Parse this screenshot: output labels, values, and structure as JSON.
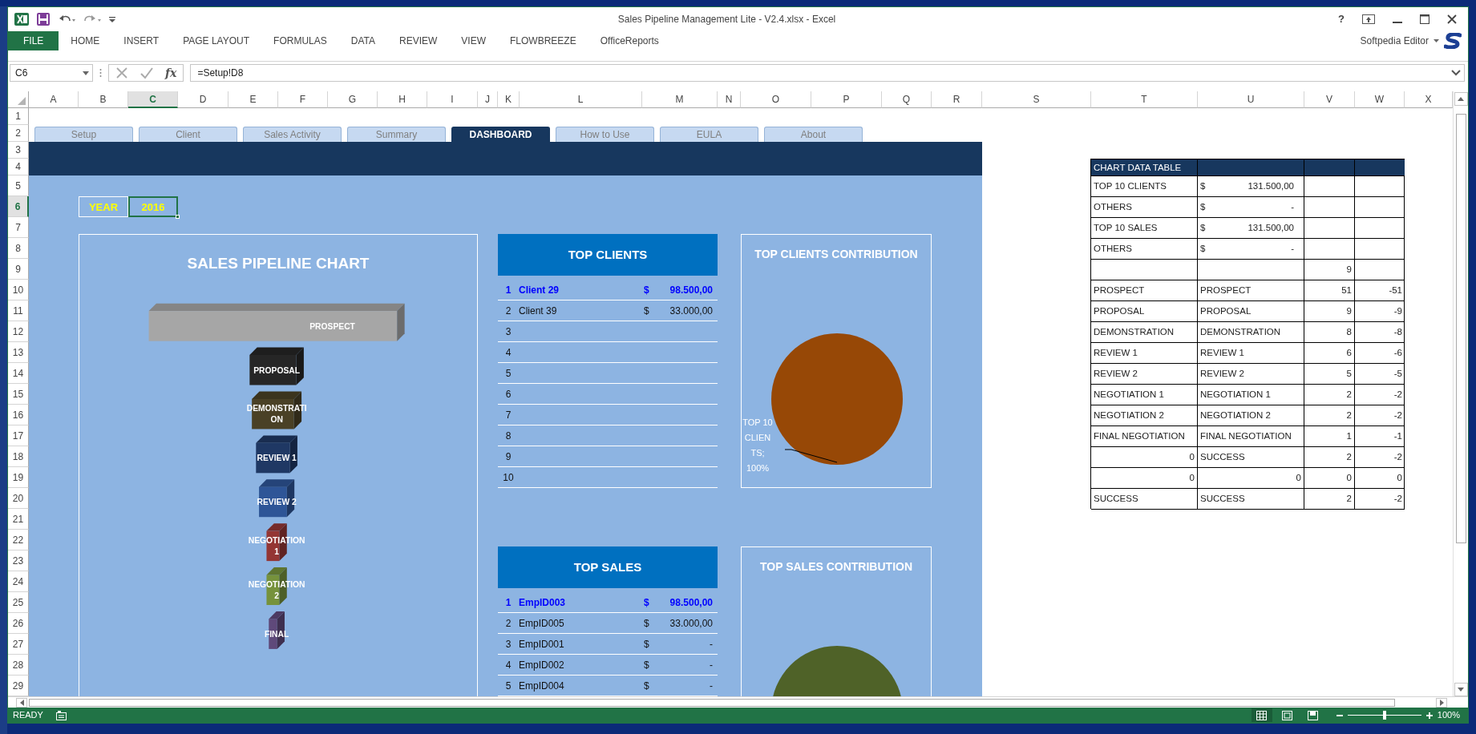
{
  "window": {
    "title": "Sales Pipeline Management Lite - V2.4.xlsx - Excel",
    "help_label": "?"
  },
  "ribbon": {
    "tabs": [
      {
        "label": "FILE",
        "kind": "file"
      },
      {
        "label": "HOME",
        "kind": "tab"
      },
      {
        "label": "INSERT",
        "kind": "tab"
      },
      {
        "label": "PAGE LAYOUT",
        "kind": "tab"
      },
      {
        "label": "FORMULAS",
        "kind": "tab"
      },
      {
        "label": "DATA",
        "kind": "tab"
      },
      {
        "label": "REVIEW",
        "kind": "tab"
      },
      {
        "label": "VIEW",
        "kind": "tab"
      },
      {
        "label": "FLOWBREEZE",
        "kind": "tab"
      },
      {
        "label": "OfficeReports",
        "kind": "tab"
      }
    ],
    "user": "Softpedia Editor"
  },
  "formula_bar": {
    "name_box": "C6",
    "function_label": "fx",
    "formula": "=Setup!D8"
  },
  "columns": [
    {
      "label": "A",
      "selected": false
    },
    {
      "label": "B",
      "selected": false
    },
    {
      "label": "C",
      "selected": true
    },
    {
      "label": "D",
      "selected": false
    },
    {
      "label": "E",
      "selected": false
    },
    {
      "label": "F",
      "selected": false
    },
    {
      "label": "G",
      "selected": false
    },
    {
      "label": "H",
      "selected": false
    },
    {
      "label": "I",
      "selected": false
    },
    {
      "label": "J",
      "selected": false
    },
    {
      "label": "K",
      "selected": false
    },
    {
      "label": "L",
      "selected": false
    },
    {
      "label": "M",
      "selected": false
    },
    {
      "label": "N",
      "selected": false
    },
    {
      "label": "O",
      "selected": false
    },
    {
      "label": "P",
      "selected": false
    },
    {
      "label": "Q",
      "selected": false
    },
    {
      "label": "R",
      "selected": false
    },
    {
      "label": "S",
      "selected": false
    },
    {
      "label": "T",
      "selected": false
    },
    {
      "label": "U",
      "selected": false
    },
    {
      "label": "V",
      "selected": false
    },
    {
      "label": "W",
      "selected": false
    },
    {
      "label": "X",
      "selected": false
    }
  ],
  "rows": [
    {
      "label": "1",
      "selected": false
    },
    {
      "label": "2",
      "selected": false
    },
    {
      "label": "3",
      "selected": false
    },
    {
      "label": "4",
      "selected": false
    },
    {
      "label": "5",
      "selected": false
    },
    {
      "label": "6",
      "selected": true
    },
    {
      "label": "7",
      "selected": false
    },
    {
      "label": "8",
      "selected": false
    },
    {
      "label": "9",
      "selected": false
    },
    {
      "label": "10",
      "selected": false
    },
    {
      "label": "11",
      "selected": false
    },
    {
      "label": "12",
      "selected": false
    },
    {
      "label": "13",
      "selected": false
    },
    {
      "label": "14",
      "selected": false
    },
    {
      "label": "15",
      "selected": false
    },
    {
      "label": "16",
      "selected": false
    },
    {
      "label": "17",
      "selected": false
    },
    {
      "label": "18",
      "selected": false
    },
    {
      "label": "19",
      "selected": false
    },
    {
      "label": "20",
      "selected": false
    },
    {
      "label": "21",
      "selected": false
    },
    {
      "label": "22",
      "selected": false
    },
    {
      "label": "23",
      "selected": false
    },
    {
      "label": "24",
      "selected": false
    },
    {
      "label": "25",
      "selected": false
    },
    {
      "label": "26",
      "selected": false
    },
    {
      "label": "27",
      "selected": false
    },
    {
      "label": "28",
      "selected": false
    },
    {
      "label": "29",
      "selected": false
    }
  ],
  "sheet_tabs": [
    {
      "label": "Setup",
      "selected": false
    },
    {
      "label": "Client",
      "selected": false
    },
    {
      "label": "Sales Activity",
      "selected": false
    },
    {
      "label": "Summary",
      "selected": false
    },
    {
      "label": "DASHBOARD",
      "selected": true
    },
    {
      "label": "How to Use",
      "selected": false
    },
    {
      "label": "EULA",
      "selected": false
    },
    {
      "label": "About",
      "selected": false
    }
  ],
  "year": {
    "label": "YEAR",
    "value": "2016",
    "selected": true
  },
  "pipeline_chart": {
    "title": "SALES PIPELINE CHART",
    "stages": [
      {
        "label_lines": [
          "PROSPECT"
        ],
        "color": "#a6a6a6"
      },
      {
        "label_lines": [
          "PROPOSAL"
        ],
        "color": "#262626"
      },
      {
        "label_lines": [
          "DEMONSTRATI",
          "ON"
        ],
        "color": "#4a4126"
      },
      {
        "label_lines": [
          "REVIEW 1"
        ],
        "color": "#1f3864"
      },
      {
        "label_lines": [
          "REVIEW 2"
        ],
        "color": "#2e5597"
      },
      {
        "label_lines": [
          "NEGOTIATION",
          "1"
        ],
        "color": "#943634"
      },
      {
        "label_lines": [
          "NEGOTIATION",
          "2"
        ],
        "color": "#76923c"
      },
      {
        "label_lines": [
          "FINAL"
        ],
        "color": "#5f497a"
      }
    ]
  },
  "top_clients": {
    "title": "TOP CLIENTS",
    "rows": [
      {
        "rank": "1",
        "name": "Client 29",
        "currency": "$",
        "amount": "98.500,00",
        "highlighted": true
      },
      {
        "rank": "2",
        "name": "Client 39",
        "currency": "$",
        "amount": "33.000,00",
        "highlighted": false
      },
      {
        "rank": "3",
        "highlighted": false
      },
      {
        "rank": "4",
        "highlighted": false
      },
      {
        "rank": "5",
        "highlighted": false
      },
      {
        "rank": "6",
        "highlighted": false
      },
      {
        "rank": "7",
        "highlighted": false
      },
      {
        "rank": "8",
        "highlighted": false
      },
      {
        "rank": "9",
        "highlighted": false
      },
      {
        "rank": "10",
        "highlighted": false
      }
    ]
  },
  "clients_contribution": {
    "chart_data": {
      "type": "pie",
      "title": "TOP CLIENTS CONTRIBUTION",
      "series": [
        {
          "color": "#974806",
          "values": [
            100
          ]
        }
      ],
      "value_labels": [
        "TOP 10 CLIENTS; 100%"
      ]
    }
  },
  "top_sales": {
    "title": "TOP SALES",
    "rows": [
      {
        "rank": "1",
        "name": "EmpID003",
        "currency": "$",
        "amount": "98.500,00",
        "highlighted": true
      },
      {
        "rank": "2",
        "name": "EmpID005",
        "currency": "$",
        "amount": "33.000,00",
        "highlighted": false
      },
      {
        "rank": "3",
        "name": "EmpID001",
        "currency": "$",
        "amount": "-",
        "highlighted": false
      },
      {
        "rank": "4",
        "name": "EmpID002",
        "currency": "$",
        "amount": "-",
        "highlighted": false
      },
      {
        "rank": "5",
        "name": "EmpID004",
        "currency": "$",
        "amount": "-",
        "highlighted": false
      }
    ]
  },
  "sales_contribution": {
    "title": "TOP SALES CONTRIBUTION"
  },
  "chart_data_table": {
    "title": "CHART DATA TABLE",
    "rows": [
      [
        {
          "kind": "text",
          "text": "TOP 10 CLIENTS"
        },
        {
          "kind": "money",
          "currency": "$",
          "text": "131.500,00"
        },
        {
          "kind": "empty"
        },
        {
          "kind": "empty"
        }
      ],
      [
        {
          "kind": "text",
          "text": "OTHERS"
        },
        {
          "kind": "money",
          "currency": "$",
          "text": "-"
        },
        {
          "kind": "empty"
        },
        {
          "kind": "empty"
        }
      ],
      [
        {
          "kind": "text",
          "text": "TOP 10 SALES"
        },
        {
          "kind": "money",
          "currency": "$",
          "text": "131.500,00"
        },
        {
          "kind": "empty"
        },
        {
          "kind": "empty"
        }
      ],
      [
        {
          "kind": "text",
          "text": "OTHERS"
        },
        {
          "kind": "money",
          "currency": "$",
          "text": "-"
        },
        {
          "kind": "empty"
        },
        {
          "kind": "empty"
        }
      ],
      [
        {
          "kind": "empty"
        },
        {
          "kind": "empty"
        },
        {
          "kind": "number",
          "text": "9"
        },
        {
          "kind": "empty"
        }
      ],
      [
        {
          "kind": "text",
          "text": "PROSPECT"
        },
        {
          "kind": "text",
          "text": "PROSPECT"
        },
        {
          "kind": "number",
          "text": "51"
        },
        {
          "kind": "number",
          "text": "-51"
        }
      ],
      [
        {
          "kind": "text",
          "text": "PROPOSAL"
        },
        {
          "kind": "text",
          "text": "PROPOSAL"
        },
        {
          "kind": "number",
          "text": "9"
        },
        {
          "kind": "number",
          "text": "-9"
        }
      ],
      [
        {
          "kind": "text",
          "text": "DEMONSTRATION"
        },
        {
          "kind": "text",
          "text": "DEMONSTRATION"
        },
        {
          "kind": "number",
          "text": "8"
        },
        {
          "kind": "number",
          "text": "-8"
        }
      ],
      [
        {
          "kind": "text",
          "text": "REVIEW 1"
        },
        {
          "kind": "text",
          "text": "REVIEW 1"
        },
        {
          "kind": "number",
          "text": "6"
        },
        {
          "kind": "number",
          "text": "-6"
        }
      ],
      [
        {
          "kind": "text",
          "text": "REVIEW 2"
        },
        {
          "kind": "text",
          "text": "REVIEW 2"
        },
        {
          "kind": "number",
          "text": "5"
        },
        {
          "kind": "number",
          "text": "-5"
        }
      ],
      [
        {
          "kind": "text",
          "text": "NEGOTIATION 1"
        },
        {
          "kind": "text",
          "text": "NEGOTIATION 1"
        },
        {
          "kind": "number",
          "text": "2"
        },
        {
          "kind": "number",
          "text": "-2"
        }
      ],
      [
        {
          "kind": "text",
          "text": "NEGOTIATION 2"
        },
        {
          "kind": "text",
          "text": "NEGOTIATION 2"
        },
        {
          "kind": "number",
          "text": "2"
        },
        {
          "kind": "number",
          "text": "-2"
        }
      ],
      [
        {
          "kind": "text",
          "text": "FINAL NEGOTIATION"
        },
        {
          "kind": "text",
          "text": "FINAL NEGOTIATION"
        },
        {
          "kind": "number",
          "text": "1"
        },
        {
          "kind": "number",
          "text": "-1"
        }
      ],
      [
        {
          "kind": "number",
          "text": "0"
        },
        {
          "kind": "text",
          "text": "SUCCESS"
        },
        {
          "kind": "number",
          "text": "2"
        },
        {
          "kind": "number",
          "text": "-2"
        }
      ],
      [
        {
          "kind": "number",
          "text": "0"
        },
        {
          "kind": "number",
          "text": "0"
        },
        {
          "kind": "number",
          "text": "0"
        },
        {
          "kind": "number",
          "text": "0"
        }
      ],
      [
        {
          "kind": "text",
          "text": "SUCCESS"
        },
        {
          "kind": "text",
          "text": "SUCCESS"
        },
        {
          "kind": "number",
          "text": "2"
        },
        {
          "kind": "number",
          "text": "-2"
        }
      ]
    ]
  },
  "status_bar": {
    "mode": "READY",
    "views": [
      {
        "kind": "normal",
        "selected": true
      },
      {
        "kind": "page_layout",
        "selected": false
      },
      {
        "kind": "page_break",
        "selected": false
      }
    ],
    "zoom": {
      "level": 0.5,
      "label": "100%"
    }
  }
}
